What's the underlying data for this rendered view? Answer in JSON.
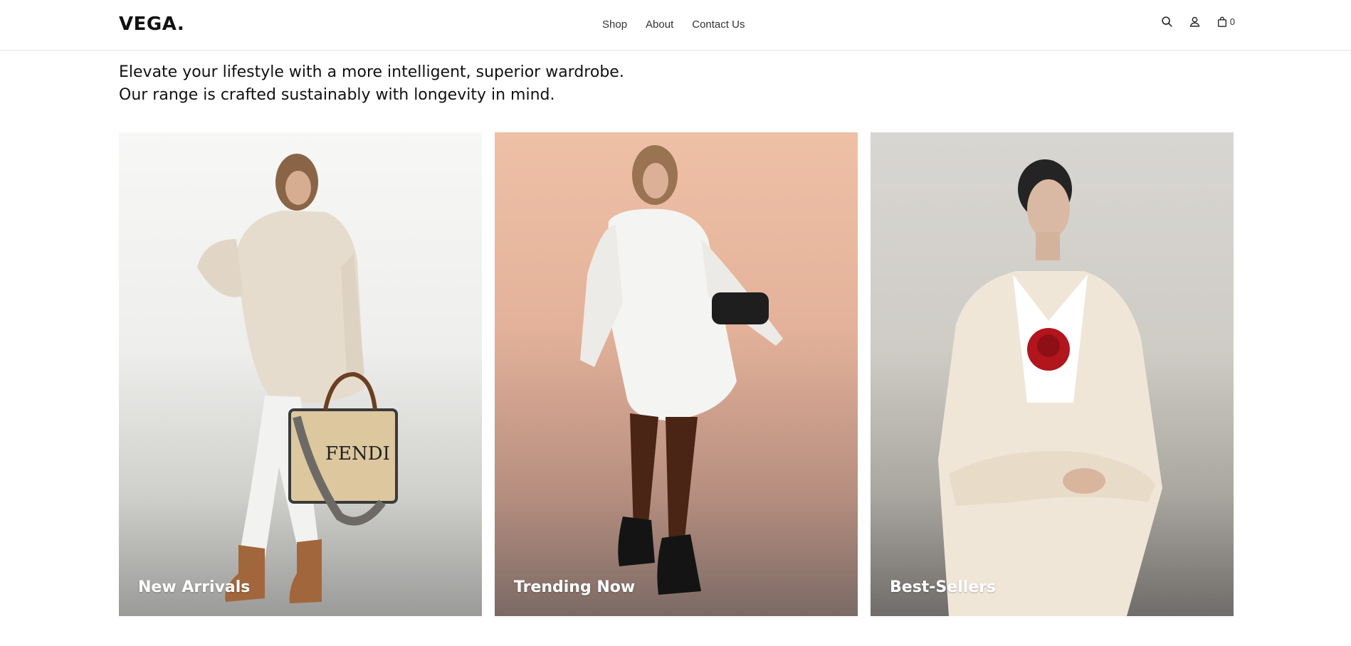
{
  "brand": {
    "logo": "VEGA."
  },
  "nav": {
    "items": [
      "Shop",
      "About",
      "Contact Us"
    ]
  },
  "header_icons": {
    "search": "search-icon",
    "account": "user-icon",
    "cart": "shopping-bag-icon",
    "cart_count": "0"
  },
  "hero": {
    "line1": "Elevate your lifestyle with a more intelligent, superior wardrobe.",
    "line2": "Our range is crafted sustainably with longevity in mind."
  },
  "collections": [
    {
      "label": "New Arrivals"
    },
    {
      "label": "Trending Now"
    },
    {
      "label": "Best-Sellers"
    }
  ],
  "colors": {
    "card1_bg": "#eeeeec",
    "card2_bg": "#e4b29a",
    "card3_bg": "#cfccc6",
    "label_text": "#ffffff"
  }
}
